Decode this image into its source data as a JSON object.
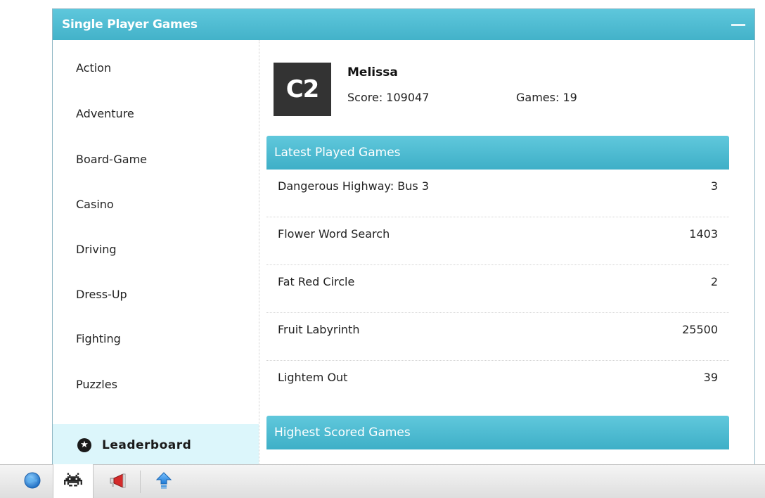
{
  "panel": {
    "title": "Single Player Games"
  },
  "sidebar": {
    "categories": [
      "Action",
      "Adventure",
      "Board-Game",
      "Casino",
      "Driving",
      "Dress-Up",
      "Fighting",
      "Puzzles"
    ],
    "leaderboard_label": "Leaderboard"
  },
  "user": {
    "avatar_text": "C2",
    "name": "Melissa",
    "score_text": "Score: 109047",
    "games_text": "Games: 19"
  },
  "latest": {
    "title": "Latest Played Games",
    "games": [
      {
        "name": "Dangerous Highway: Bus 3",
        "score": "3"
      },
      {
        "name": "Flower Word Search",
        "score": "1403"
      },
      {
        "name": "Fat Red Circle",
        "score": "2"
      },
      {
        "name": "Fruit Labyrinth",
        "score": "25500"
      },
      {
        "name": "Lightem Out",
        "score": "39"
      }
    ]
  },
  "highest": {
    "title": "Highest Scored Games"
  },
  "taskbar": {
    "icons": [
      "globe-icon",
      "space-invader-icon",
      "megaphone-icon",
      "upload-arrow-icon"
    ]
  },
  "colors": {
    "accent": "#4dbdd3",
    "leaderboard_bg": "#dcf6fb"
  }
}
